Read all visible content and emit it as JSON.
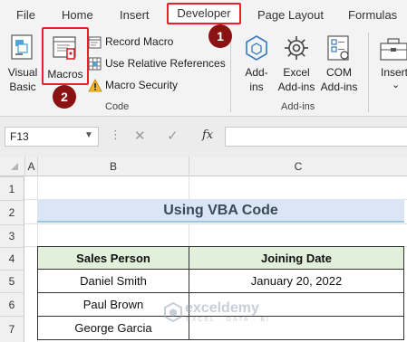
{
  "ribbon_tabs": [
    "File",
    "Home",
    "Insert",
    "Developer",
    "Page Layout",
    "Formulas"
  ],
  "ribbon": {
    "code_group": {
      "visual_basic_line1": "Visual",
      "visual_basic_line2": "Basic",
      "macros": "Macros",
      "record_macro": "Record Macro",
      "use_relative": "Use Relative References",
      "macro_security": "Macro Security",
      "group_label": "Code"
    },
    "addins_group": {
      "addins_line1": "Add-",
      "addins_line2": "ins",
      "excel_addins_line1": "Excel",
      "excel_addins_line2": "Add-ins",
      "com_addins_line1": "COM",
      "com_addins_line2": "Add-ins",
      "group_label": "Add-ins"
    },
    "controls_group": {
      "insert": "Insert",
      "insert_caret": "⌄"
    }
  },
  "steps": {
    "step1": "1",
    "step2": "2"
  },
  "formula_bar": {
    "name_box": "F13",
    "cancel": "✕",
    "enter": "✓",
    "fx": "fx",
    "formula": ""
  },
  "columns": [
    "A",
    "B",
    "C"
  ],
  "rows": [
    "1",
    "2",
    "3",
    "4",
    "5",
    "6",
    "7"
  ],
  "sheet": {
    "title": "Using VBA Code",
    "headers": [
      "Sales Person",
      "Joining Date"
    ],
    "data": [
      [
        "Daniel Smith",
        "January 20, 2022"
      ],
      [
        "Paul Brown",
        ""
      ],
      [
        "George Garcia",
        ""
      ]
    ]
  },
  "watermark": {
    "name": "exceldemy",
    "tagline": "EXCEL · DATA · BI"
  },
  "colors": {
    "highlight_red": "#e8202a",
    "badge": "#8b1212",
    "title_fill": "#dae6f3",
    "header_fill": "#e2efda"
  }
}
